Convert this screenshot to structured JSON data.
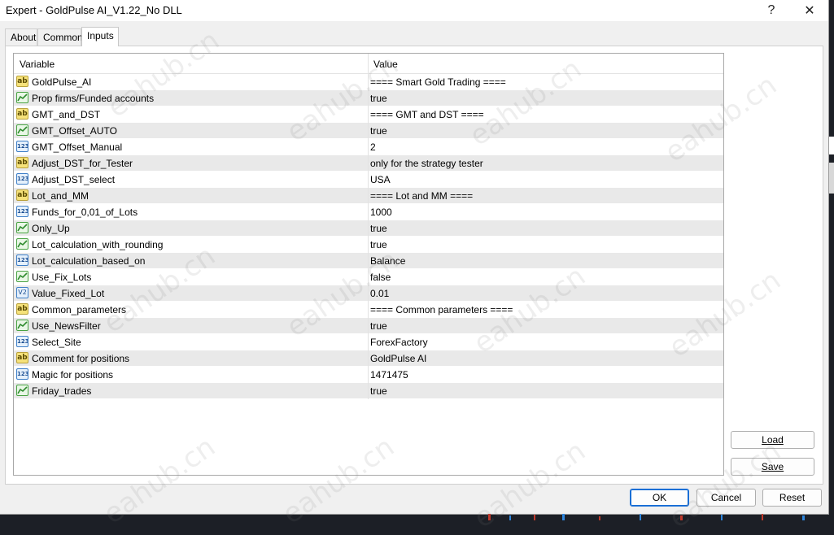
{
  "window": {
    "title": "Expert - GoldPulse AI_V1.22_No DLL",
    "help_glyph": "?",
    "close_glyph": "✕"
  },
  "tabs": [
    {
      "label": "About",
      "active": false
    },
    {
      "label": "Common",
      "active": false
    },
    {
      "label": "Inputs",
      "active": true
    }
  ],
  "grid": {
    "col_variable": "Variable",
    "col_value": "Value",
    "rows": [
      {
        "type": "string",
        "variable": "GoldPulse_AI",
        "value": "==== Smart Gold Trading ===="
      },
      {
        "type": "bool",
        "variable": "Prop firms/Funded accounts",
        "value": "true"
      },
      {
        "type": "string",
        "variable": "GMT_and_DST",
        "value": "==== GMT and DST ===="
      },
      {
        "type": "bool",
        "variable": "GMT_Offset_AUTO",
        "value": "true"
      },
      {
        "type": "int",
        "variable": "GMT_Offset_Manual",
        "value": "2"
      },
      {
        "type": "string",
        "variable": "Adjust_DST_for_Tester",
        "value": "only for the strategy tester"
      },
      {
        "type": "int",
        "variable": "Adjust_DST_select",
        "value": "USA"
      },
      {
        "type": "string",
        "variable": "Lot_and_MM",
        "value": "==== Lot and MM ===="
      },
      {
        "type": "int",
        "variable": "Funds_for_0,01_of_Lots",
        "value": "1000"
      },
      {
        "type": "bool",
        "variable": "Only_Up",
        "value": "true"
      },
      {
        "type": "bool",
        "variable": "Lot_calculation_with_rounding",
        "value": "true"
      },
      {
        "type": "int",
        "variable": "Lot_calculation_based_on",
        "value": "Balance"
      },
      {
        "type": "bool",
        "variable": "Use_Fix_Lots",
        "value": "false"
      },
      {
        "type": "double",
        "variable": "Value_Fixed_Lot",
        "value": "0.01"
      },
      {
        "type": "string",
        "variable": "Common_parameters",
        "value": "==== Common parameters ===="
      },
      {
        "type": "bool",
        "variable": "Use_NewsFilter",
        "value": "true"
      },
      {
        "type": "int",
        "variable": "Select_Site",
        "value": "ForexFactory"
      },
      {
        "type": "string",
        "variable": "Comment for positions",
        "value": "GoldPulse AI"
      },
      {
        "type": "int",
        "variable": "Magic for positions",
        "value": "1471475"
      },
      {
        "type": "bool",
        "variable": "Friday_trades",
        "value": "true"
      }
    ]
  },
  "icon_text": {
    "string": "ab",
    "int": "123",
    "double": "V2"
  },
  "buttons": {
    "load": "Load",
    "save": "Save",
    "ok": "OK",
    "cancel": "Cancel",
    "reset": "Reset"
  },
  "watermark": "eahub.cn",
  "colors": {
    "primary_button_border": "#1a6fd6",
    "alt_row": "#e9e9e9",
    "string_icon": "#f6e27a",
    "bool_icon_line": "#49a343",
    "int_icon": "#3e7fc8"
  }
}
